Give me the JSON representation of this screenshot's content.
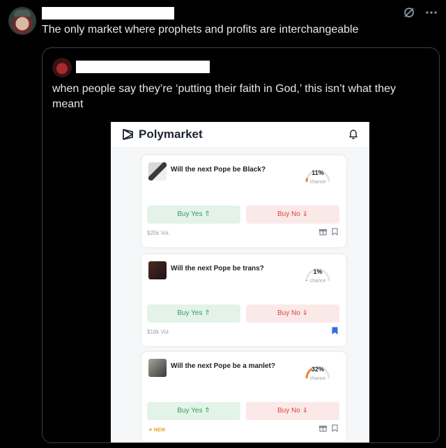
{
  "post": {
    "text": "The only market where prophets and profits are interchangeable"
  },
  "quoted_post": {
    "text": "when people say they’re ‘putting their faith in God,’ this isn’t what they meant"
  },
  "polymarket": {
    "brand": "Polymarket",
    "markets": [
      {
        "question": "Will the next Pope be Black?",
        "percent": "11%",
        "chance_fraction": 0.11,
        "chance_label": "chance",
        "buy_yes": "Buy Yes ⇑",
        "buy_no": "Buy No ⇓",
        "footer": "$25k Vol.",
        "bookmarked": false
      },
      {
        "question": "Will the next Pope be trans?",
        "percent": "1%",
        "chance_fraction": 0.01,
        "chance_label": "chance",
        "buy_yes": "Buy Yes ⇑",
        "buy_no": "Buy No ⇓",
        "footer": "$18k Vol.",
        "bookmarked": true
      },
      {
        "question": "Will the next Pope be a manlet?",
        "percent": "32%",
        "chance_fraction": 0.32,
        "chance_label": "chance",
        "buy_yes": "Buy Yes ⇑",
        "buy_no": "Buy No ⇓",
        "footer": "✦ NEW",
        "bookmarked": false
      }
    ]
  },
  "colors": {
    "background": "#000000",
    "yes_green": "#2e9e5a",
    "no_red": "#d7463c",
    "gauge_fill": "#e8833a",
    "bookmark_blue": "#2f6fe4"
  }
}
